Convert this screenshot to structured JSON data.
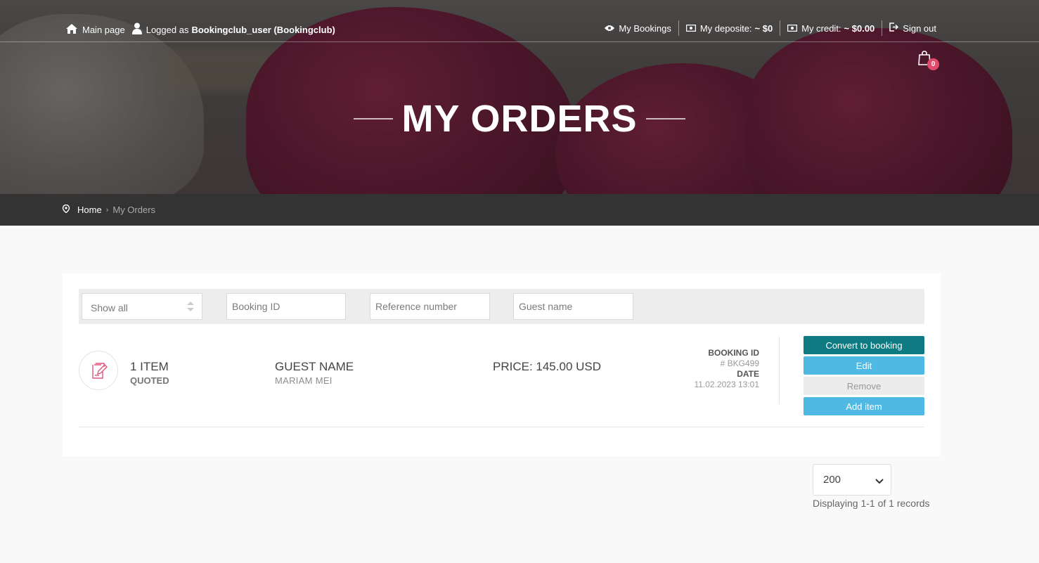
{
  "topbar": {
    "main_page": "Main page",
    "logged_as_prefix": "Logged as",
    "logged_as_user": "Bookingclub_user (Bookingclub)",
    "my_bookings": "My Bookings",
    "deposite_label": "My deposite:",
    "deposite_value": "~ $0",
    "credit_label": "My credit:",
    "credit_value": "~ $0.00",
    "sign_out": "Sign out",
    "cart_count": "0"
  },
  "hero": {
    "title": "MY ORDERS"
  },
  "breadcrumb": {
    "home": "Home",
    "separator": "›",
    "current": "My Orders"
  },
  "filters": {
    "status_selected": "Show all",
    "booking_id_placeholder": "Booking ID",
    "reference_placeholder": "Reference number",
    "guest_placeholder": "Guest name"
  },
  "orders": [
    {
      "items_count": "1 ITEM",
      "status": "QUOTED",
      "guest_label": "GUEST NAME",
      "guest_name": "MARIAM MEI",
      "price": "PRICE: 145.00 USD",
      "booking_id_label": "BOOKING ID",
      "booking_id": "# BKG499",
      "date_label": "DATE",
      "date": "11.02.2023 13:01",
      "actions": {
        "convert": "Convert to booking",
        "edit": "Edit",
        "remove": "Remove",
        "add_item": "Add item"
      }
    }
  ],
  "pagination": {
    "page_size": "200",
    "records_text": "Displaying 1-1 of 1 records"
  },
  "colors": {
    "accent_teal": "#0e7b82",
    "accent_blue": "#4fb9e4",
    "badge": "#e24b6a",
    "crumb_bar": "#333333"
  }
}
